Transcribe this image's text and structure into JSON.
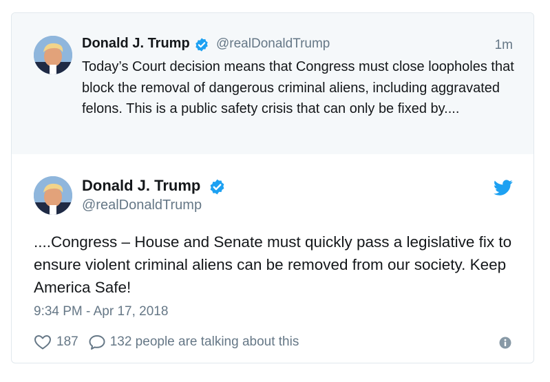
{
  "colors": {
    "verified_blue": "#1da1f2",
    "text_primary": "#14171a",
    "text_secondary": "#657786",
    "parent_background": "#f5f8fa",
    "border": "#e1e8ed"
  },
  "parent_tweet": {
    "avatar_icon": "profile-photo",
    "name": "Donald J. Trump",
    "verified_icon": "verified-badge-icon",
    "handle": "@realDonaldTrump",
    "time": "1m",
    "text": "Today’s Court decision means that Congress must close loopholes that block the removal of dangerous criminal aliens, including aggravated felons. This is a public safety crisis that can only be fixed by...."
  },
  "main_tweet": {
    "avatar_icon": "profile-photo",
    "name": "Donald J. Trump",
    "verified_icon": "verified-badge-icon",
    "handle": "@realDonaldTrump",
    "brand_icon": "twitter-bird-icon",
    "text": "....Congress – House and Senate must quickly pass a legislative fix to ensure violent criminal aliens can be removed from our society. Keep America Safe!",
    "timestamp": "9:34 PM - Apr 17, 2018",
    "likes": "187",
    "replies_text": "132 people are talking about this",
    "like_icon": "heart-icon",
    "reply_icon": "speech-bubble-icon",
    "info_icon": "info-icon"
  }
}
